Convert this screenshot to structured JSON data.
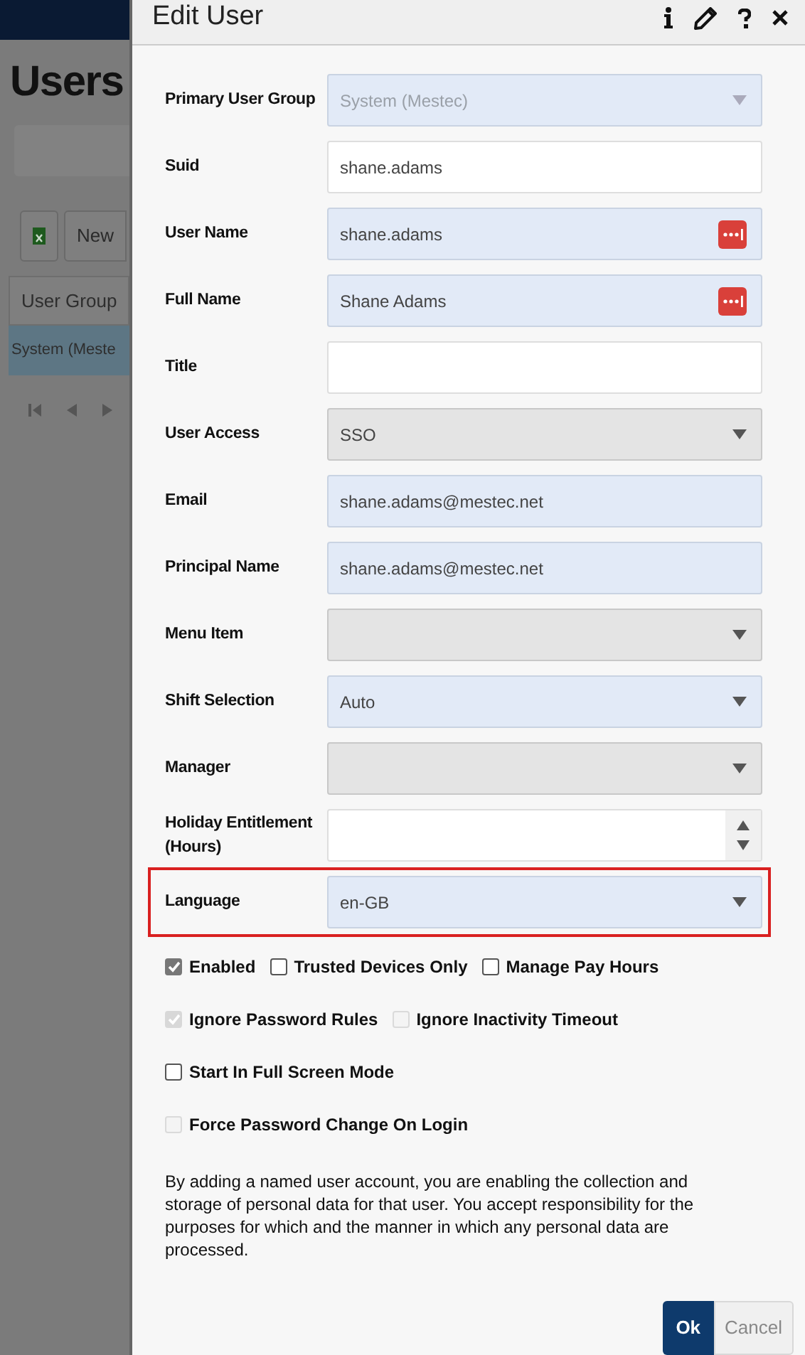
{
  "background": {
    "title": "Users",
    "toolbar": {
      "new_button": "New"
    },
    "table": {
      "column_header": "User Group",
      "rows": [
        {
          "cell": "System (Meste",
          "selected": true
        }
      ]
    }
  },
  "dialog": {
    "title": "Edit User",
    "fields": [
      {
        "label": "Primary User Group",
        "kind": "select",
        "value": "System (Mestec)",
        "autofilled": true,
        "disabled": true
      },
      {
        "label": "Suid",
        "kind": "text",
        "value": "shane.adams",
        "autofilled": false,
        "readonly": false
      },
      {
        "label": "User Name",
        "kind": "text",
        "value": "shane.adams",
        "autofilled": true,
        "password_manager": true
      },
      {
        "label": "Full Name",
        "kind": "text",
        "value": "Shane Adams",
        "autofilled": true,
        "password_manager": true
      },
      {
        "label": "Title",
        "kind": "text",
        "autofilled": false,
        "readonly": false
      },
      {
        "label": "User Access",
        "kind": "select",
        "value": "SSO",
        "autofilled": false,
        "readonly": true
      },
      {
        "label": "Email",
        "kind": "text",
        "value": "shane.adams@mestec.net",
        "autofilled": true
      },
      {
        "label": "Principal Name",
        "kind": "text",
        "value": "shane.adams@mestec.net",
        "autofilled": true
      },
      {
        "label": "Menu Item",
        "kind": "select",
        "autofilled": false,
        "readonly": true
      },
      {
        "label": "Shift Selection",
        "kind": "select",
        "value": "Auto",
        "autofilled": true
      },
      {
        "label": "Manager",
        "kind": "select",
        "autofilled": false,
        "readonly": true
      },
      {
        "label": "Holiday Entitlement (Hours)",
        "kind": "spinner",
        "autofilled": false,
        "readonly": false
      },
      {
        "label": "Language",
        "kind": "select",
        "value": "en-GB",
        "autofilled": true,
        "outlined": true
      }
    ],
    "checkbox_rows": [
      [
        {
          "label": "Enabled",
          "checked": true,
          "disabled": false
        },
        {
          "label": "Trusted Devices Only",
          "checked": false,
          "disabled": false
        },
        {
          "label": "Manage Pay Hours",
          "checked": false,
          "disabled": false
        }
      ],
      [
        {
          "label": "Ignore Password Rules",
          "checked": true,
          "disabled": true
        },
        {
          "label": "Ignore Inactivity Timeout",
          "checked": false,
          "disabled": true
        }
      ],
      [
        {
          "label": "Start In Full Screen Mode",
          "checked": false,
          "disabled": false
        }
      ],
      [
        {
          "label": "Force Password Change On Login",
          "checked": false,
          "disabled": true
        }
      ]
    ],
    "notice": "By adding a named user account, you are enabling the collection and storage of personal data for that user.  You accept responsibility for the purposes for which and the manner in which any personal data are processed.",
    "buttons": [
      {
        "label": "Ok",
        "kind": "primary"
      },
      {
        "label": "Cancel",
        "kind": "secondary"
      }
    ]
  }
}
